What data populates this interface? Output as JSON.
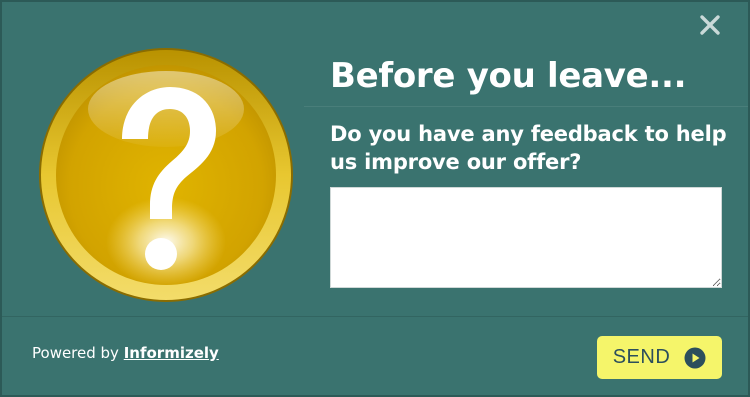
{
  "popup": {
    "title": "Before you leave...",
    "question": "Do you have any feedback to help us improve our offer?",
    "feedback_value": "",
    "close_icon": "close-icon",
    "illustration_icon": "question-mark-icon"
  },
  "footer": {
    "powered_prefix": "Powered by",
    "brand_link": "Informizely",
    "send_label": "SEND",
    "send_icon": "play-circle-icon"
  },
  "colors": {
    "background": "#3a736f",
    "send_button": "#f5f56a",
    "send_text": "#2c4f5c",
    "question_gold": "#d4a800"
  }
}
